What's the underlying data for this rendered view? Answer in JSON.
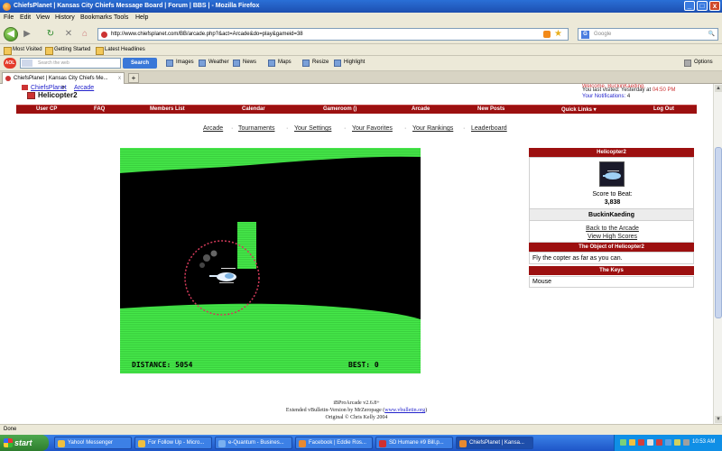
{
  "window": {
    "title": "ChiefsPlanet | Kansas City Chiefs Message Board | Forum | BBS | - Mozilla Firefox",
    "min_label": "_",
    "max_label": "□",
    "close_label": "x"
  },
  "menu": [
    "File",
    "Edit",
    "View",
    "History",
    "Bookmarks",
    "Tools",
    "Help"
  ],
  "nav": {
    "back": "◀",
    "forward": "▶",
    "reload": "↻",
    "stop": "✕",
    "home": "⌂",
    "url": "http://www.chiefsplanet.com/BB/arcade.php?&act=Arcade&do=play&gameid=38",
    "search_placeholder": "Google",
    "search_go": "🔍"
  },
  "bookmarks": [
    "Most Visited",
    "Getting Started",
    "Latest Headlines"
  ],
  "toolbar": {
    "aol": "AOL",
    "search_placeholder": "Search the web",
    "search_button": "Search",
    "items": [
      "Images",
      "Weather",
      "News",
      "Maps",
      "Resize",
      "Highlight"
    ],
    "options": "Options"
  },
  "tab": {
    "title": "ChiefsPlanet | Kansas City Chiefs Me...",
    "close": "x",
    "new": "+"
  },
  "breadcrumb": {
    "site": "ChiefsPlanet",
    "sep": ">",
    "section": "Arcade"
  },
  "page_title": "Helicopter2",
  "user": {
    "welcome": "Welcome, BuckinKaeding.",
    "last_visited_label": "You last visited: Yesterday at",
    "last_visited_time": "04:50 PM",
    "notifications_label": "Your Notifications:",
    "notifications_count": "4"
  },
  "rednav": [
    "User CP",
    "FAQ",
    "Members List",
    "Calendar",
    "Gameroom ()",
    "Arcade",
    "New Posts",
    "Quick Links ▾",
    "Log Out"
  ],
  "arcade_nav": [
    "Arcade",
    "Tournaments",
    "Your Settings",
    "Your Favorites",
    "Your Rankings",
    "Leaderboard"
  ],
  "game": {
    "distance_label": "DISTANCE: 5054",
    "best_label": "BEST: 0",
    "distance": 5054,
    "best": 0,
    "colors": {
      "wall": "#46e84a",
      "cave": "#000000",
      "ring": "#d23a5a"
    }
  },
  "panel": {
    "game_name": "Helicopter2",
    "score_to_beat_label": "Score to Beat:",
    "score_to_beat": "3,838",
    "holder": "BuckinKaeding",
    "back_link": "Back to the Arcade",
    "high_scores_link": "View High Scores",
    "object_heading": "The Object of Helicopter2",
    "object_text": "Fly the copter as far as you can.",
    "keys_heading": "The Keys",
    "keys_text": "Mouse"
  },
  "footer": {
    "line1": "iBProArcade v2.6.8+",
    "line2_prefix": "Extended vBulletin-Version by MrZeropage (",
    "line2_link": "www.vbulletin.org",
    "line2_suffix": ")",
    "line3": "Original © Chris Kelly 2004"
  },
  "status": "Done",
  "taskbar": {
    "start": "start",
    "tasks": [
      "Yahoo! Messenger",
      "For Follow Up - Micro...",
      "e-Quantum - Busines...",
      "Facebook | Eddie Ros...",
      "SD Humane #9 Bill.p...",
      "ChiefsPlanet | Kansa..."
    ],
    "clock": "10:53 AM"
  }
}
